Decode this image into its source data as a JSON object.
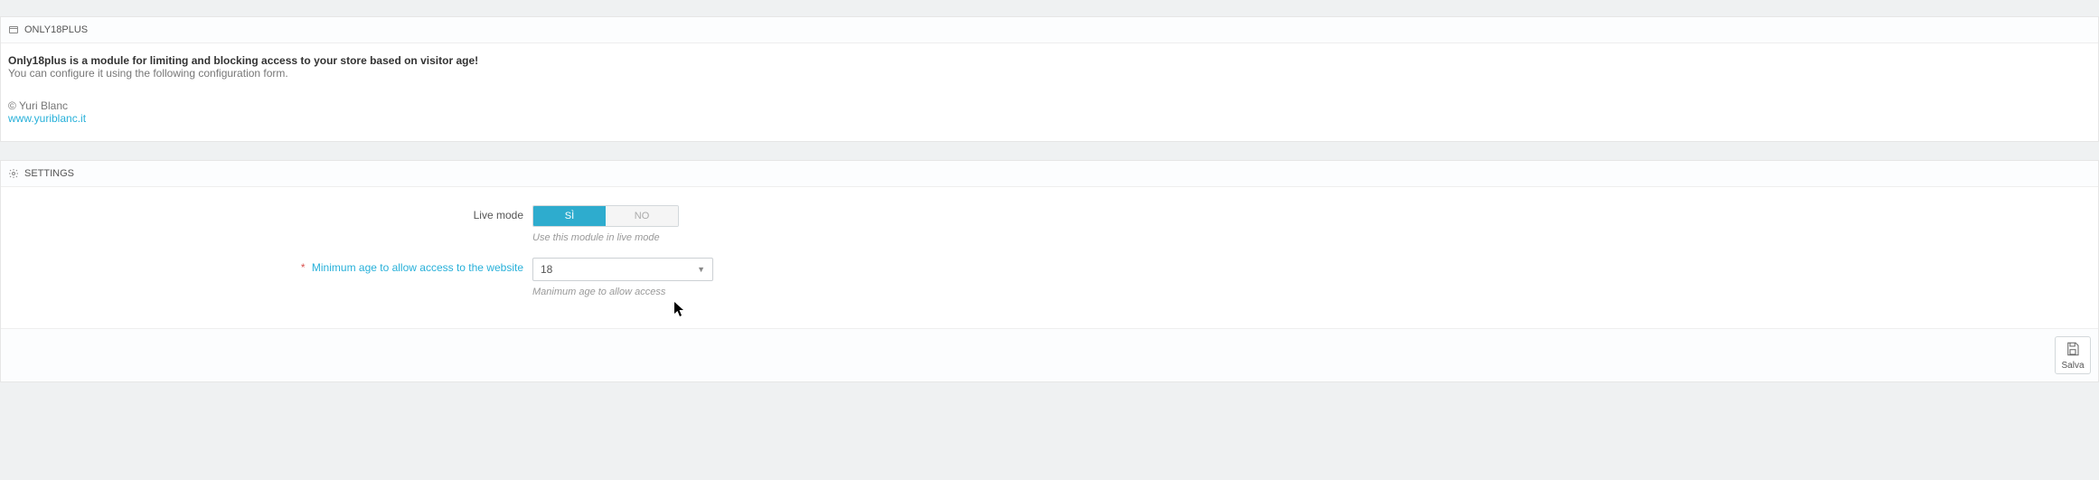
{
  "info_panel": {
    "title": "ONLY18PLUS",
    "headline": "Only18plus is a module for limiting and blocking access to your store based on visitor age!",
    "subline": "You can configure it using the following configuration form.",
    "copyright": "© Yuri Blanc",
    "link_text": "www.yuriblanc.it"
  },
  "settings_panel": {
    "title": "SETTINGS",
    "live_mode": {
      "label": "Live mode",
      "option_yes": "SÌ",
      "option_no": "NO",
      "value": "yes",
      "help": "Use this module in live mode"
    },
    "min_age": {
      "label": "Minimum age to allow access to the website",
      "value": "18",
      "help": "Manimum age to allow access"
    },
    "save_button": "Salva"
  }
}
